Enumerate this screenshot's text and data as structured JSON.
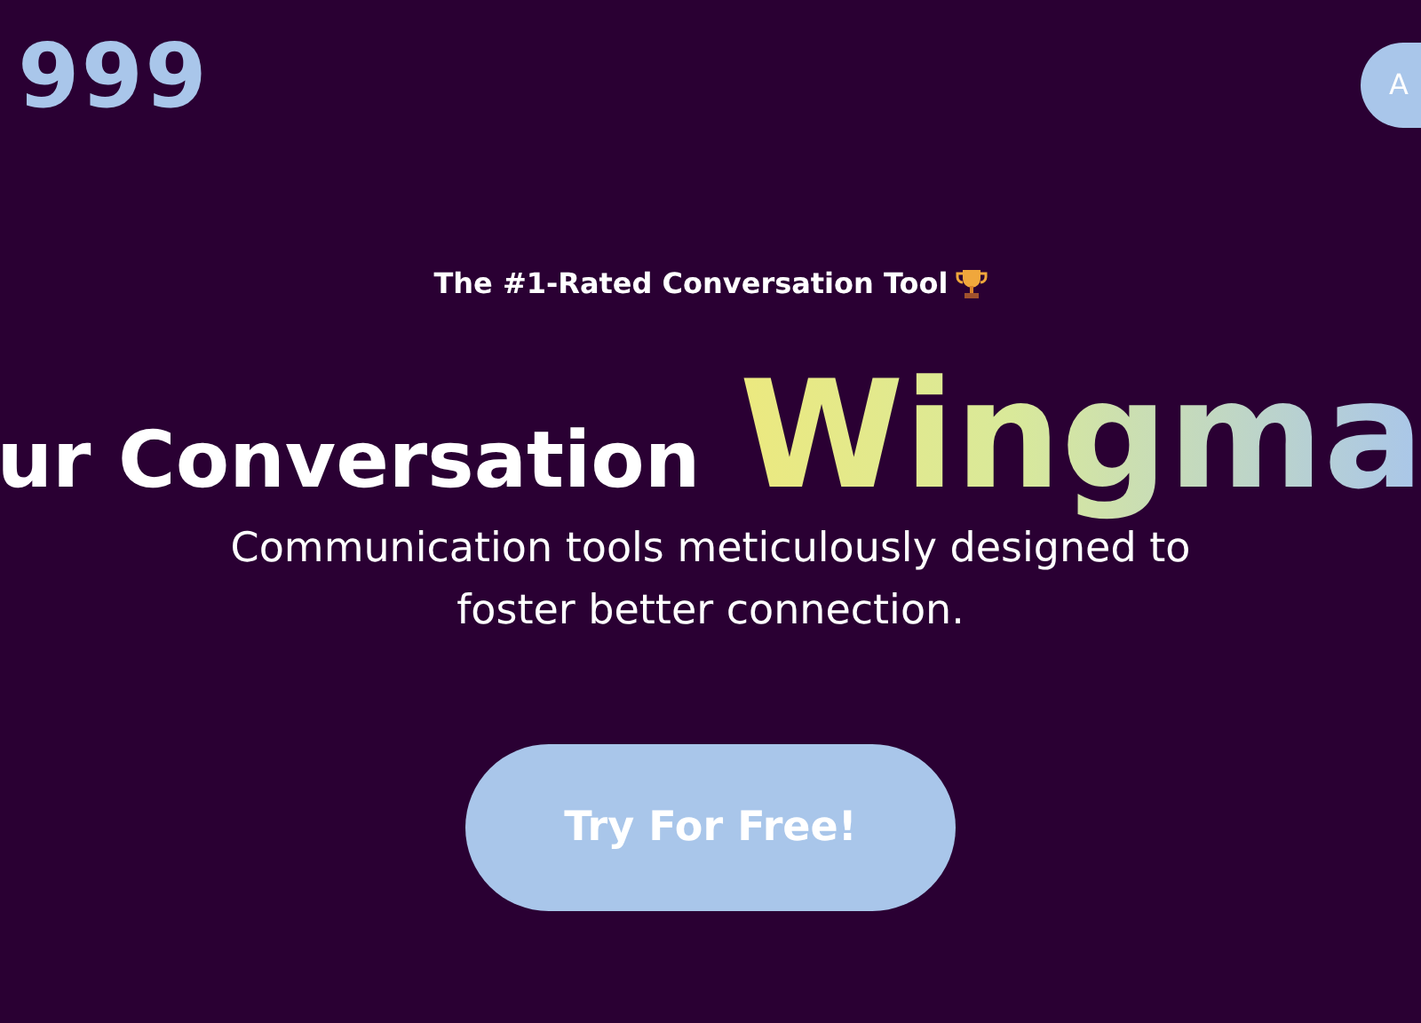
{
  "header": {
    "logo": "999",
    "button": "A"
  },
  "hero": {
    "eyebrow": "The #1-Rated Conversation Tool",
    "headline": "ur Conversation",
    "highlight": "Wingma",
    "subtitle": "Communication tools meticulously designed to foster better connection.",
    "cta": "Try For Free!"
  }
}
